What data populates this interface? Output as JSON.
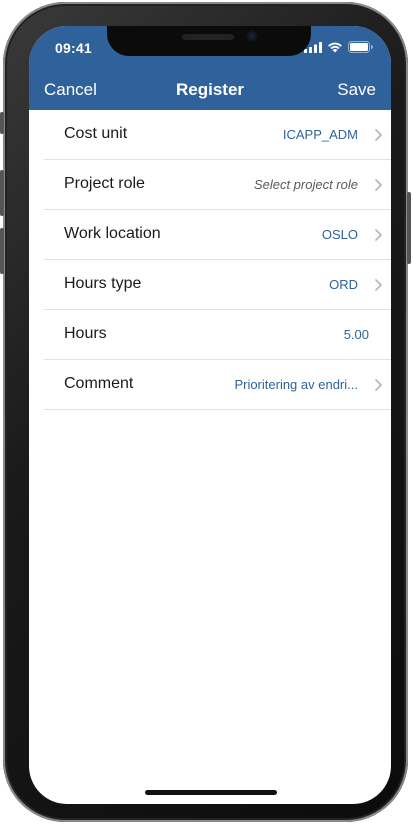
{
  "status_bar": {
    "time": "09:41"
  },
  "nav": {
    "cancel_label": "Cancel",
    "title": "Register",
    "save_label": "Save"
  },
  "colors": {
    "header_bg": "#2f629a",
    "value_text": "#2f629a"
  },
  "rows": [
    {
      "label": "Cost unit",
      "value": "ICAPP_ADM",
      "chevron": true
    },
    {
      "label": "Project role",
      "value": "Select project role",
      "chevron": true,
      "placeholder": true
    },
    {
      "label": "Work location",
      "value": "OSLO",
      "chevron": true
    },
    {
      "label": "Hours type",
      "value": "ORD",
      "chevron": true
    },
    {
      "label": "Hours",
      "value": "5.00",
      "chevron": false
    },
    {
      "label": "Comment",
      "value": "Prioritering av endri...",
      "chevron": true
    }
  ],
  "icons": {
    "signal": "cellular-signal-icon",
    "wifi": "wifi-icon",
    "battery": "battery-icon",
    "chevron": "chevron-right-icon"
  }
}
